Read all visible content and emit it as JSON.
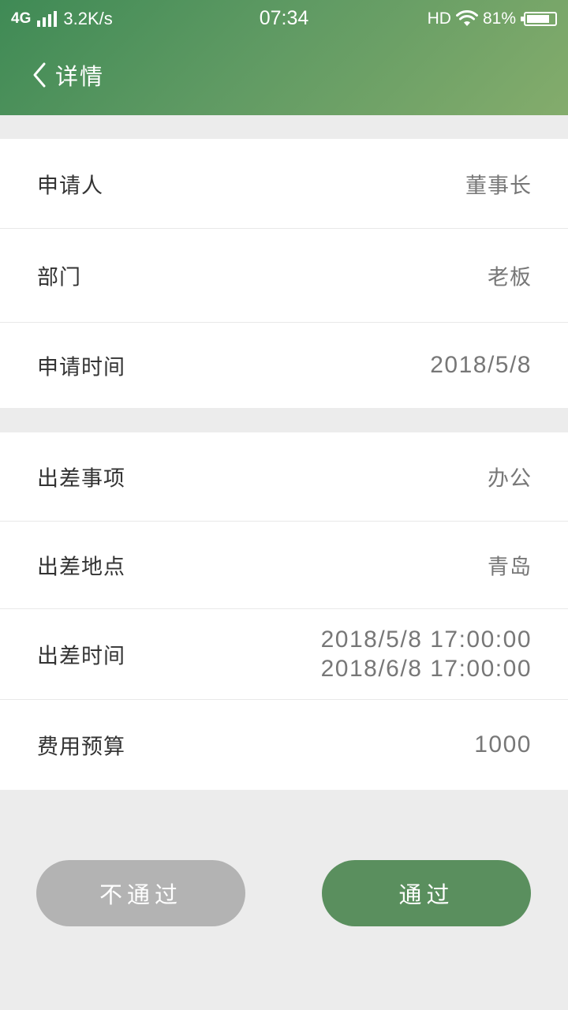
{
  "status_bar": {
    "network": "4G",
    "speed": "3.2K/s",
    "time": "07:34",
    "hd": "HD",
    "battery": "81%",
    "battery_level": 0.81
  },
  "header": {
    "back_icon": "chevron-left-icon",
    "title": "详情"
  },
  "applicant_section": {
    "rows": [
      {
        "label": "申请人",
        "value": "董事长"
      },
      {
        "label": "部门",
        "value": "老板"
      },
      {
        "label": "申请时间",
        "value": "2018/5/8"
      }
    ]
  },
  "trip_section": {
    "rows": [
      {
        "label": "出差事项",
        "value": "办公"
      },
      {
        "label": "出差地点",
        "value": "青岛"
      },
      {
        "label": "出差时间",
        "value_start": "2018/5/8 17:00:00",
        "value_end": "2018/6/8 17:00:00"
      },
      {
        "label": "费用预算",
        "value": "1000"
      }
    ]
  },
  "actions": {
    "reject_label": "不通过",
    "approve_label": "通过",
    "reject_color": "#b3b3b3",
    "approve_color": "#5a8f5e"
  },
  "colors": {
    "header_gradient_start": "#3f8a55",
    "header_gradient_end": "#84ac6c",
    "background": "#ececec"
  }
}
